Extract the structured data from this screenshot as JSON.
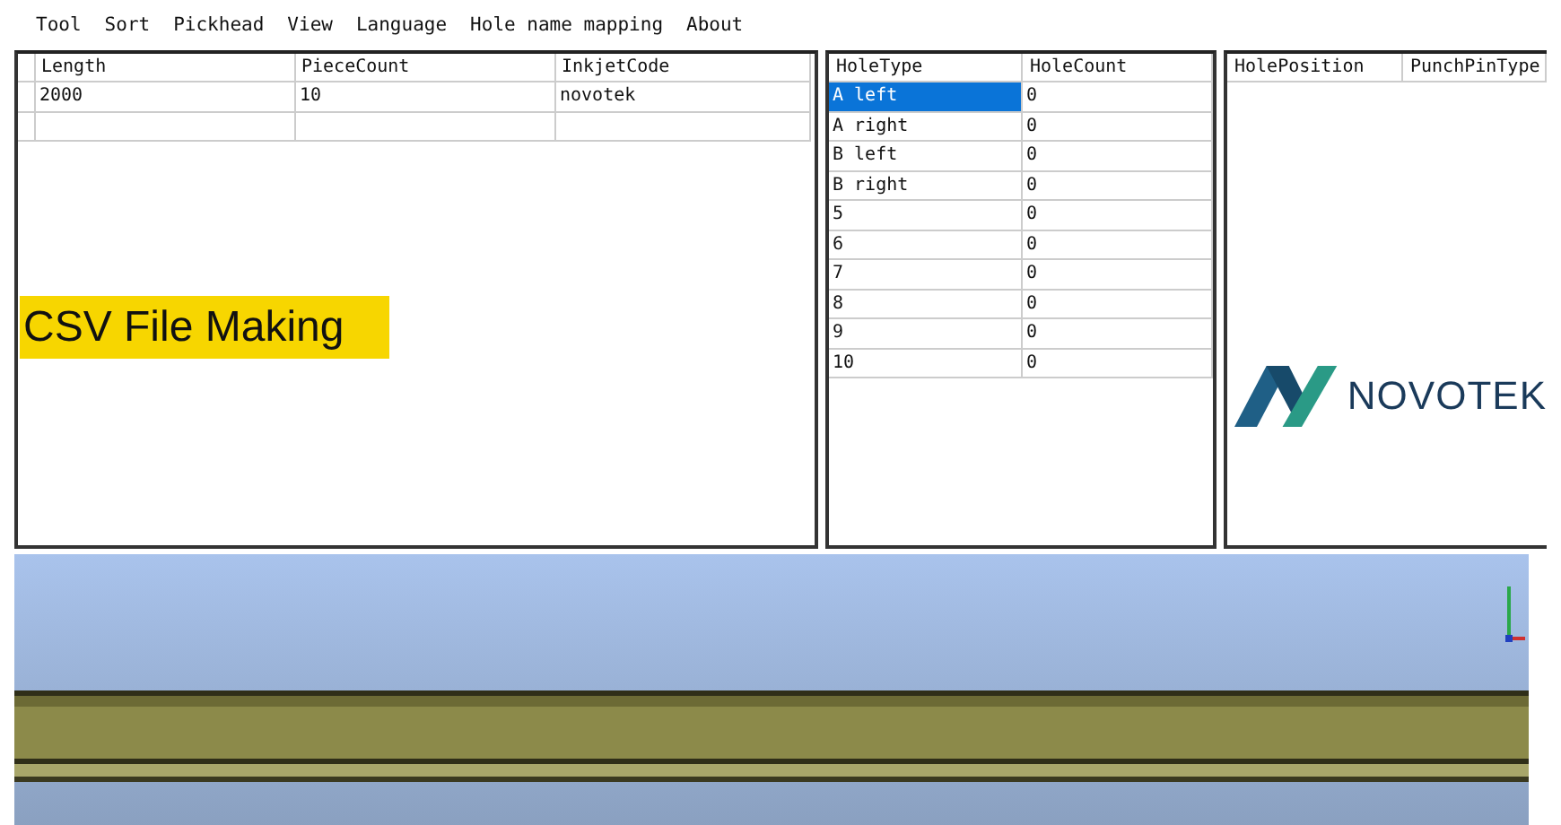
{
  "menu": [
    "Tool",
    "Sort",
    "Pickhead",
    "View",
    "Language",
    "Hole name mapping",
    "About"
  ],
  "main_table": {
    "columns": [
      "Length",
      "PieceCount",
      "InkjetCode"
    ],
    "rows": [
      {
        "cells": [
          "2000",
          "10",
          "novotek"
        ]
      }
    ]
  },
  "caption": "CSV File Making",
  "hole_table": {
    "columns": [
      "HoleType",
      "HoleCount"
    ],
    "rows": [
      {
        "hole_type": "A left",
        "hole_count": "0",
        "selected": true
      },
      {
        "hole_type": "A right",
        "hole_count": "0",
        "selected": false
      },
      {
        "hole_type": "B left",
        "hole_count": "0",
        "selected": false
      },
      {
        "hole_type": "B right",
        "hole_count": "0",
        "selected": false
      },
      {
        "hole_type": "5",
        "hole_count": "0",
        "selected": false
      },
      {
        "hole_type": "6",
        "hole_count": "0",
        "selected": false
      },
      {
        "hole_type": "7",
        "hole_count": "0",
        "selected": false
      },
      {
        "hole_type": "8",
        "hole_count": "0",
        "selected": false
      },
      {
        "hole_type": "9",
        "hole_count": "0",
        "selected": false
      },
      {
        "hole_type": "10",
        "hole_count": "0",
        "selected": false
      }
    ]
  },
  "position_table": {
    "columns": [
      "HolePosition",
      "PunchPinType"
    ]
  },
  "logo": {
    "text": "NOVOTEK"
  }
}
